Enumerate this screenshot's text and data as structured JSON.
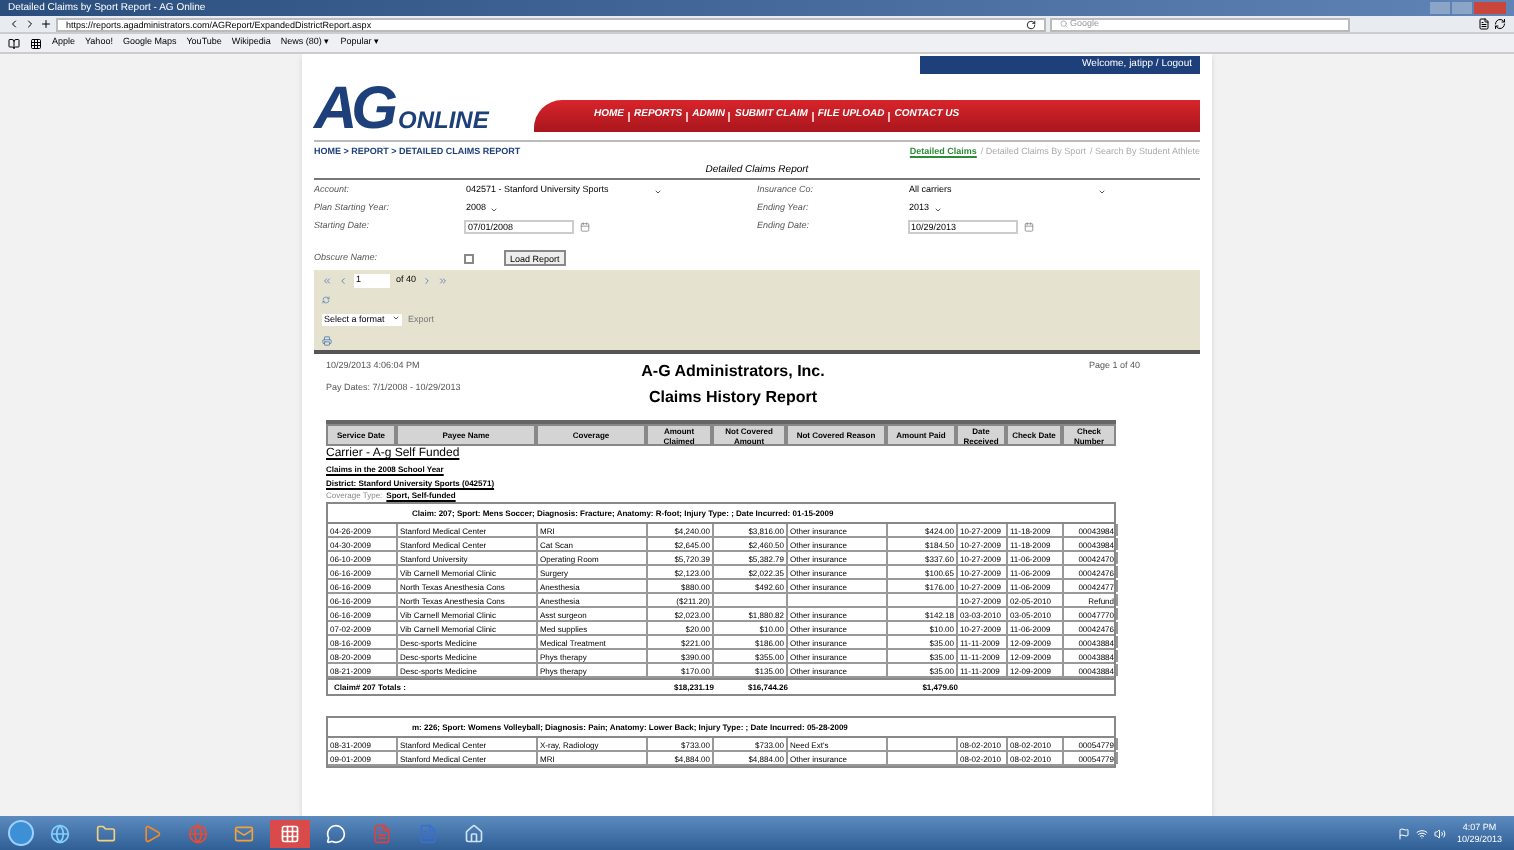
{
  "window": {
    "title": "Detailed Claims by Sport Report - AG Online"
  },
  "browser": {
    "url": "https://reports.agadministrators.com/AGReport/ExpandedDistrictReport.aspx",
    "search_placeholder": "Google",
    "bookmarks": [
      "Apple",
      "Yahoo!",
      "Google Maps",
      "YouTube",
      "Wikipedia",
      "News (80) ▾",
      "Popular ▾"
    ]
  },
  "site": {
    "welcome": "Welcome, jatipp / Logout",
    "logo_mark": "AG",
    "logo_text": "ONLINE",
    "nav": [
      "HOME",
      "REPORTS",
      "ADMIN",
      "SUBMIT CLAIM",
      "FILE UPLOAD",
      "CONTACT US"
    ],
    "breadcrumb": "HOME > REPORT > DETAILED CLAIMS REPORT",
    "report_links": [
      {
        "label": "Detailed Claims",
        "selected": true
      },
      {
        "label": "/ Detailed Claims By Sport",
        "selected": false
      },
      {
        "label": "/ Search By Student Athlete",
        "selected": false
      }
    ],
    "form_title": "Detailed Claims Report",
    "fields": [
      {
        "label": "Account:",
        "value": "042571 - Stanford University Sports",
        "kind": "select"
      },
      {
        "label": "Insurance Co:",
        "value": "All carriers",
        "kind": "select"
      },
      {
        "label": "Plan Starting Year:",
        "value": "2008",
        "kind": "small_select"
      },
      {
        "label": "Ending Year:",
        "value": "2013",
        "kind": "small_select"
      },
      {
        "label": "Starting Date:",
        "value": "07/01/2008",
        "kind": "date"
      },
      {
        "label": "Ending Date:",
        "value": "10/29/2013",
        "kind": "date"
      }
    ],
    "obscure": {
      "label": "Obscure Name:",
      "checked": false
    },
    "load_button": "Load Report",
    "pager": {
      "page": "1",
      "of": "of 40"
    },
    "format": {
      "value": "Select a format",
      "export": "Export"
    }
  },
  "report": {
    "timestamp": "10/29/2013 4:06:04 PM",
    "pay_dates": "Pay Dates: 7/1/2008 - 10/29/2013",
    "company": "A-G Administrators, Inc.",
    "title": "Claims History Report",
    "page": "Page 1 of 40",
    "columns": [
      "Service Date",
      "Payee Name",
      "Coverage",
      "Amount Claimed",
      "Not Covered Amount",
      "Not Covered Reason",
      "Amount Paid",
      "Date Received",
      "Check Date",
      "Check Number"
    ],
    "carrier": "Carrier - A-g Self Funded",
    "school_year": "Claims in the 2008 School Year",
    "district": "District: Stanford University Sports (042571)",
    "coverage_label": "Coverage Type:",
    "coverage_value": "Sport, Self-funded",
    "claims": [
      {
        "header": "Claim: 207; Sport: Mens Soccer; Diagnosis: Fracture; Anatomy: R-foot; Injury Type: ; Date Incurred: 01-15-2009",
        "rows": [
          [
            "04-26-2009",
            "Stanford Medical Center",
            "MRI",
            "$4,240.00",
            "$3,816.00",
            "Other insurance",
            "$424.00",
            "10-27-2009",
            "11-18-2009",
            "00043984"
          ],
          [
            "04-30-2009",
            "Stanford Medical Center",
            "Cat Scan",
            "$2,645.00",
            "$2,460.50",
            "Other insurance",
            "$184.50",
            "10-27-2009",
            "11-18-2009",
            "00043984"
          ],
          [
            "06-10-2009",
            "Stanford University",
            "Operating Room",
            "$5,720.39",
            "$5,382.79",
            "Other insurance",
            "$337.60",
            "10-27-2009",
            "11-06-2009",
            "00042470"
          ],
          [
            "06-16-2009",
            "Vib Carnell Memorial Clinic",
            "Surgery",
            "$2,123.00",
            "$2,022.35",
            "Other insurance",
            "$100.65",
            "10-27-2009",
            "11-06-2009",
            "00042476"
          ],
          [
            "06-16-2009",
            "North Texas Anesthesia Cons",
            "Anesthesia",
            "$880.00",
            "$492.60",
            "Other insurance",
            "$176.00",
            "10-27-2009",
            "11-06-2009",
            "00042477"
          ],
          [
            "06-16-2009",
            "North Texas Anesthesia Cons",
            "Anesthesia",
            "($211.20)",
            "",
            "",
            "",
            "10-27-2009",
            "02-05-2010",
            "Refund"
          ],
          [
            "06-16-2009",
            "Vib Carnell Memorial Clinic",
            "Asst surgeon",
            "$2,023.00",
            "$1,880.82",
            "Other insurance",
            "$142.18",
            "03-03-2010",
            "03-05-2010",
            "00047770"
          ],
          [
            "07-02-2009",
            "Vib Carnell Memorial Clinic",
            "Med supplies",
            "$20.00",
            "$10.00",
            "Other insurance",
            "$10.00",
            "10-27-2009",
            "11-06-2009",
            "00042476"
          ],
          [
            "08-16-2009",
            "Desc-sports Medicine",
            "Medical Treatment",
            "$221.00",
            "$186.00",
            "Other insurance",
            "$35.00",
            "11-11-2009",
            "12-09-2009",
            "00043884"
          ],
          [
            "08-20-2009",
            "Desc-sports Medicine",
            "Phys therapy",
            "$390.00",
            "$355.00",
            "Other insurance",
            "$35.00",
            "11-11-2009",
            "12-09-2009",
            "00043884"
          ],
          [
            "08-21-2009",
            "Desc-sports Medicine",
            "Phys therapy",
            "$170.00",
            "$135.00",
            "Other insurance",
            "$35.00",
            "11-11-2009",
            "12-09-2009",
            "00043884"
          ]
        ],
        "totals": {
          "label": "Claim# 207 Totals :",
          "claimed": "$18,231.19",
          "not_covered": "$16,744.26",
          "paid": "$1,479.60"
        }
      },
      {
        "header": "m: 226; Sport: Womens Volleyball; Diagnosis: Pain; Anatomy: Lower Back; Injury Type: ; Date Incurred: 05-28-2009",
        "rows": [
          [
            "08-31-2009",
            "Stanford Medical Center",
            "X-ray, Radiology",
            "$733.00",
            "$733.00",
            "Need Ext's",
            "",
            "08-02-2010",
            "08-02-2010",
            "00054779"
          ],
          [
            "09-01-2009",
            "Stanford Medical Center",
            "MRI",
            "$4,884.00",
            "$4,884.00",
            "Other insurance",
            "",
            "08-02-2010",
            "08-02-2010",
            "00054779"
          ]
        ]
      }
    ]
  },
  "taskbar": {
    "time": "4:07 PM",
    "date": "10/29/2013"
  }
}
